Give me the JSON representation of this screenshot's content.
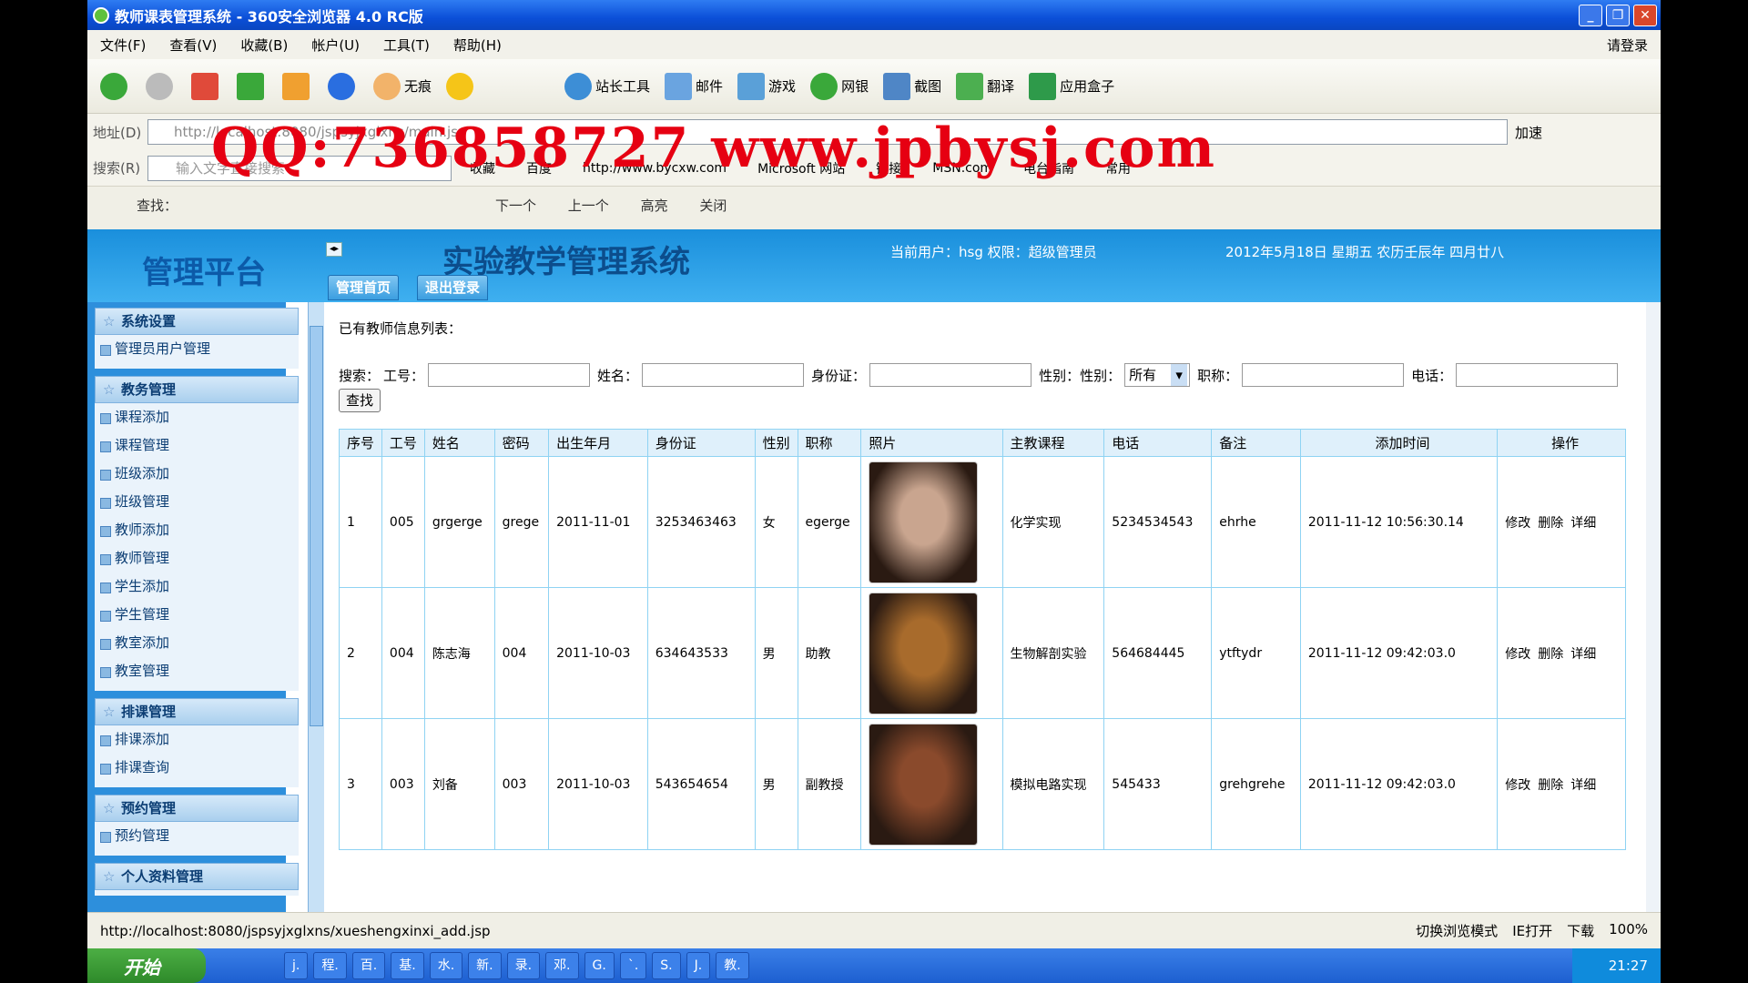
{
  "window": {
    "title": "教师课表管理系统 - 360安全浏览器 4.0 RC版"
  },
  "menu": [
    "文件(F)",
    "查看(V)",
    "收藏(B)",
    "帐户(U)",
    "工具(T)",
    "帮助(H)"
  ],
  "menu_login": "请登录",
  "toolbar": {
    "wuhen": "无痕",
    "zhanzhang": "站长工具",
    "mail": "邮件",
    "games": "游戏",
    "wangyin": "网银",
    "jietu": "截图",
    "fanyi": "翻译",
    "apps": "应用盒子"
  },
  "address": {
    "label": "地址(D)",
    "url": "http://localhost:8080/jspsyjxglxns/main.jsp",
    "speed": "加速"
  },
  "searchbar": {
    "label": "搜索(R)",
    "placeholder": "输入文字直接搜索",
    "favorites": [
      "收藏",
      "百度",
      "http://www.bycxw.com",
      "Microsoft 网站",
      "链接",
      "MSN.com",
      "电台指南",
      "常用"
    ]
  },
  "findbar": {
    "label": "查找：",
    "next": "下一个",
    "prev": "上一个",
    "highlight": "高亮",
    "close": "关闭"
  },
  "watermark": "QQ:736858727 www.jpbysj.com",
  "app": {
    "logo": "管理平台",
    "title": "实验教学管理系统",
    "current_user": "当前用户：hsg 权限：超级管理员",
    "date": "2012年5月18日 星期五 农历壬辰年 四月廿八",
    "tab_home": "管理首页",
    "tab_logout": "退出登录"
  },
  "sidebar": [
    {
      "title": "系统设置",
      "items": [
        "管理员用户管理"
      ]
    },
    {
      "title": "教务管理",
      "items": [
        "课程添加",
        "课程管理",
        "班级添加",
        "班级管理",
        "教师添加",
        "教师管理",
        "学生添加",
        "学生管理",
        "教室添加",
        "教室管理"
      ]
    },
    {
      "title": "排课管理",
      "items": [
        "排课添加",
        "排课查询"
      ]
    },
    {
      "title": "预约管理",
      "items": [
        "预约管理"
      ]
    },
    {
      "title": "个人资料管理",
      "items": []
    }
  ],
  "main": {
    "list_title": "已有教师信息列表：",
    "filters": {
      "search": "搜索：",
      "id": "工号：",
      "name": "姓名：",
      "idcard": "身份证：",
      "gender": "性别：性别：",
      "gender_value": "所有",
      "title": "职称：",
      "phone": "电话：",
      "find_button": "查找"
    },
    "table": {
      "headers": [
        "序号",
        "工号",
        "姓名",
        "密码",
        "出生年月",
        "身份证",
        "性别",
        "职称",
        "照片",
        "主教课程",
        "电话",
        "备注",
        "添加时间",
        "操作"
      ],
      "rows": [
        [
          "1",
          "005",
          "grgerge",
          "grege",
          "2011-11-01",
          "3253463463",
          "女",
          "egerge",
          "",
          "化学实现",
          "5234534543",
          "ehrhe",
          "2011-11-12 10:56:30.14"
        ],
        [
          "2",
          "004",
          "陈志海",
          "004",
          "2011-10-03",
          "634643533",
          "男",
          "助教",
          "",
          "生物解剖实验",
          "564684445",
          "ytftydr",
          "2011-11-12 09:42:03.0"
        ],
        [
          "3",
          "003",
          "刘备",
          "003",
          "2011-10-03",
          "543654654",
          "男",
          "副教授",
          "",
          "模拟电路实现",
          "545433",
          "grehgrehe",
          "2011-11-12 09:42:03.0"
        ]
      ],
      "ops": [
        "修改",
        "删除",
        "详细"
      ],
      "photo_colors": [
        "#c9a58f",
        "#a86b2c",
        "#8a4a2c"
      ]
    }
  },
  "status": {
    "url": "http://localhost:8080/jspsyjxglxns/xueshengxinxi_add.jsp",
    "mode": "切换浏览模式",
    "ie": "IE打开",
    "download": "下载",
    "zoom": "100%"
  },
  "taskbar": {
    "start": "开始",
    "items": [
      "j.",
      "程.",
      "百.",
      "基.",
      "水.",
      "新.",
      "录.",
      "邓.",
      "G.",
      "`.",
      "S.",
      "J.",
      "教."
    ],
    "time": "21:27"
  }
}
